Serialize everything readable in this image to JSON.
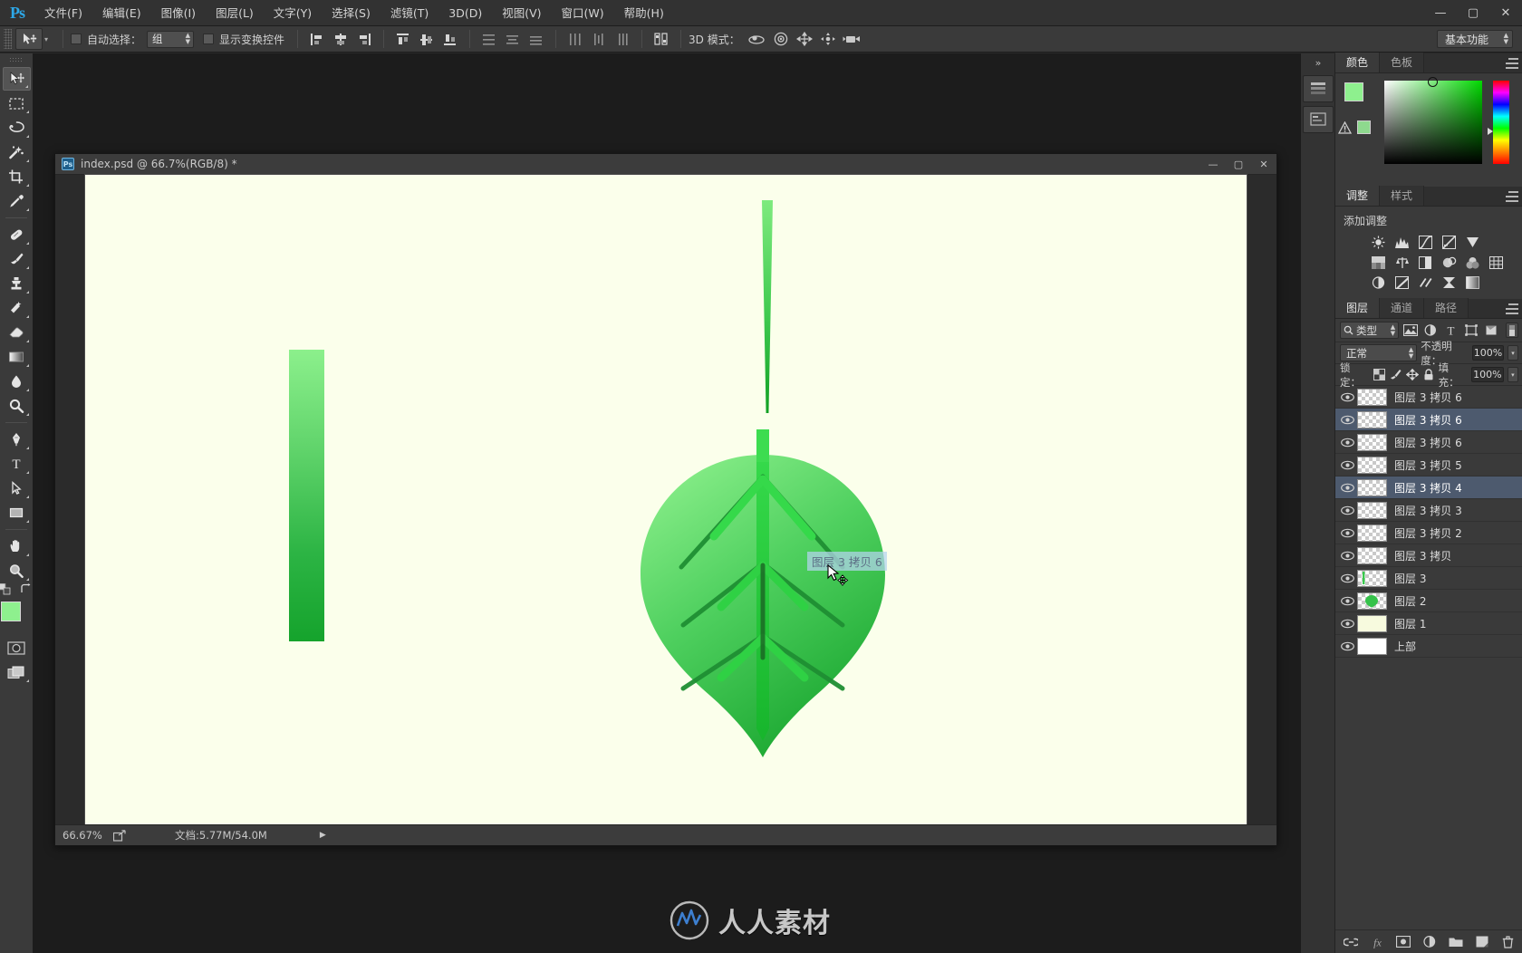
{
  "app": {
    "logo": "Ps",
    "menus": [
      {
        "label": "文件(F)"
      },
      {
        "label": "编辑(E)"
      },
      {
        "label": "图像(I)"
      },
      {
        "label": "图层(L)"
      },
      {
        "label": "文字(Y)"
      },
      {
        "label": "选择(S)"
      },
      {
        "label": "滤镜(T)"
      },
      {
        "label": "3D(D)"
      },
      {
        "label": "视图(V)"
      },
      {
        "label": "窗口(W)"
      },
      {
        "label": "帮助(H)"
      }
    ],
    "window_controls": {
      "minimize": "—",
      "maximize": "▢",
      "close": "✕"
    }
  },
  "options_bar": {
    "auto_select_label": "自动选择：",
    "auto_select_value": "组",
    "show_transform_label": "显示变换控件",
    "mode_3d_label": "3D 模式：",
    "workspace": "基本功能"
  },
  "toolbar": {
    "tools": [
      {
        "name": "move-tool",
        "glyph": "move"
      },
      {
        "name": "marquee-tool",
        "glyph": "marquee"
      },
      {
        "name": "lasso-tool",
        "glyph": "lasso"
      },
      {
        "name": "magic-wand-tool",
        "glyph": "wand"
      },
      {
        "name": "crop-tool",
        "glyph": "crop"
      },
      {
        "name": "eyedropper-tool",
        "glyph": "eyedropper"
      },
      {
        "name": "healing-brush-tool",
        "glyph": "healing"
      },
      {
        "name": "brush-tool",
        "glyph": "brush"
      },
      {
        "name": "clone-stamp-tool",
        "glyph": "stamp"
      },
      {
        "name": "history-brush-tool",
        "glyph": "historybrush"
      },
      {
        "name": "eraser-tool",
        "glyph": "eraser"
      },
      {
        "name": "gradient-tool",
        "glyph": "gradient"
      },
      {
        "name": "blur-tool",
        "glyph": "blur"
      },
      {
        "name": "dodge-tool",
        "glyph": "dodge"
      },
      {
        "name": "pen-tool",
        "glyph": "pen"
      },
      {
        "name": "type-tool",
        "glyph": "type"
      },
      {
        "name": "path-selection-tool",
        "glyph": "pathselect"
      },
      {
        "name": "shape-tool",
        "glyph": "shape"
      },
      {
        "name": "hand-tool",
        "glyph": "hand"
      },
      {
        "name": "zoom-tool",
        "glyph": "zoom"
      }
    ],
    "foreground_color": "#8ef08e",
    "background_color": "#16a416"
  },
  "document": {
    "title": "index.psd @ 66.7%(RGB/8) *",
    "icon_label": "Ps",
    "window_controls": {
      "minimize": "—",
      "maximize": "▢",
      "close": "✕"
    },
    "status": {
      "zoom": "66.67%",
      "doc_info": "文档:5.77M/54.0M",
      "expand_arrow": "▶"
    },
    "canvas": {
      "background_color": "#fbffeb",
      "drag_tooltip": "图层 3 拷贝 6",
      "leaf_gradient_from": "#8ef08e",
      "leaf_gradient_to": "#16a82c",
      "gradient_bar_from": "#8cf08c",
      "gradient_bar_to": "#15a32c"
    }
  },
  "color_panel": {
    "tabs": [
      {
        "label": "颜色",
        "active": true
      },
      {
        "label": "色板",
        "active": false
      }
    ],
    "foreground": "#8ef08e",
    "background": "#16a416",
    "web_safe_swatch": "#8ed98e"
  },
  "adjustments_panel": {
    "tabs": [
      {
        "label": "调整",
        "active": true
      },
      {
        "label": "样式",
        "active": false
      }
    ],
    "title": "添加调整",
    "icons": [
      [
        "brightness-contrast",
        "levels",
        "curves",
        "exposure",
        "vibrance"
      ],
      [
        "hue-saturation",
        "color-balance",
        "black-white",
        "photo-filter",
        "channel-mixer",
        "color-lookup"
      ],
      [
        "invert",
        "posterize",
        "threshold",
        "selective-color",
        "gradient-map"
      ]
    ]
  },
  "layers_panel": {
    "tabs": [
      {
        "label": "图层",
        "active": true
      },
      {
        "label": "通道",
        "active": false
      },
      {
        "label": "路径",
        "active": false
      }
    ],
    "filter_kind": "类型",
    "blend_mode": "正常",
    "opacity_label": "不透明度：",
    "opacity_value": "100%",
    "lock_label": "锁定：",
    "fill_label": "填充：",
    "fill_value": "100%",
    "layers": [
      {
        "name": "图层 3 拷贝 6",
        "visible": true,
        "selected": false,
        "thumb": "transparent"
      },
      {
        "name": "图层 3 拷贝 6",
        "visible": true,
        "selected": true,
        "thumb": "transparent"
      },
      {
        "name": "图层 3 拷贝 6",
        "visible": true,
        "selected": false,
        "thumb": "transparent"
      },
      {
        "name": "图层 3 拷贝 5",
        "visible": true,
        "selected": false,
        "thumb": "transparent"
      },
      {
        "name": "图层 3 拷贝 4",
        "visible": true,
        "selected": true,
        "thumb": "transparent"
      },
      {
        "name": "图层 3 拷贝 3",
        "visible": true,
        "selected": false,
        "thumb": "transparent"
      },
      {
        "name": "图层 3 拷贝 2",
        "visible": true,
        "selected": false,
        "thumb": "transparent"
      },
      {
        "name": "图层 3 拷贝",
        "visible": true,
        "selected": false,
        "thumb": "transparent"
      },
      {
        "name": "图层 3",
        "visible": true,
        "selected": false,
        "thumb": "stem"
      },
      {
        "name": "图层 2",
        "visible": true,
        "selected": false,
        "thumb": "leaf"
      },
      {
        "name": "图层 1",
        "visible": true,
        "selected": false,
        "thumb": "cream"
      },
      {
        "name": "上部",
        "visible": true,
        "selected": false,
        "thumb": "white"
      }
    ],
    "bottom_icons": [
      "link-icon",
      "fx-icon",
      "mask-icon",
      "adjustment-icon",
      "group-icon",
      "new-layer-icon",
      "delete-icon"
    ]
  },
  "watermark": {
    "text": "人人素材"
  }
}
